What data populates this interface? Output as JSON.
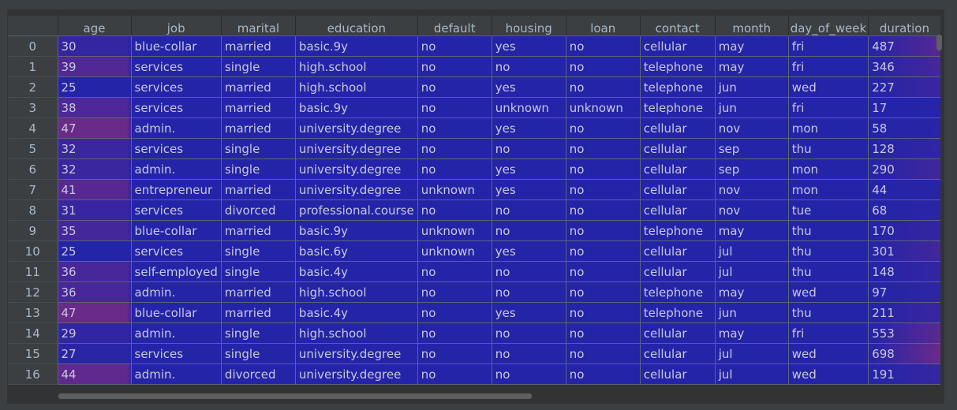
{
  "columns": [
    "",
    "age",
    "job",
    "marital",
    "education",
    "default",
    "housing",
    "loan",
    "contact",
    "month",
    "day_of_week",
    "duration"
  ],
  "rows": [
    [
      "0",
      "30",
      "blue-collar",
      "married",
      "basic.9y",
      "no",
      "yes",
      "no",
      "cellular",
      "may",
      "fri",
      "487"
    ],
    [
      "1",
      "39",
      "services",
      "single",
      "high.school",
      "no",
      "no",
      "no",
      "telephone",
      "may",
      "fri",
      "346"
    ],
    [
      "2",
      "25",
      "services",
      "married",
      "high.school",
      "no",
      "yes",
      "no",
      "telephone",
      "jun",
      "wed",
      "227"
    ],
    [
      "3",
      "38",
      "services",
      "married",
      "basic.9y",
      "no",
      "unknown",
      "unknown",
      "telephone",
      "jun",
      "fri",
      "17"
    ],
    [
      "4",
      "47",
      "admin.",
      "married",
      "university.degree",
      "no",
      "yes",
      "no",
      "cellular",
      "nov",
      "mon",
      "58"
    ],
    [
      "5",
      "32",
      "services",
      "single",
      "university.degree",
      "no",
      "no",
      "no",
      "cellular",
      "sep",
      "thu",
      "128"
    ],
    [
      "6",
      "32",
      "admin.",
      "single",
      "university.degree",
      "no",
      "yes",
      "no",
      "cellular",
      "sep",
      "mon",
      "290"
    ],
    [
      "7",
      "41",
      "entrepreneur",
      "married",
      "university.degree",
      "unknown",
      "yes",
      "no",
      "cellular",
      "nov",
      "mon",
      "44"
    ],
    [
      "8",
      "31",
      "services",
      "divorced",
      "professional.course",
      "no",
      "no",
      "no",
      "cellular",
      "nov",
      "tue",
      "68"
    ],
    [
      "9",
      "35",
      "blue-collar",
      "married",
      "basic.9y",
      "unknown",
      "no",
      "no",
      "telephone",
      "may",
      "thu",
      "170"
    ],
    [
      "10",
      "25",
      "services",
      "single",
      "basic.6y",
      "unknown",
      "yes",
      "no",
      "cellular",
      "jul",
      "thu",
      "301"
    ],
    [
      "11",
      "36",
      "self-employed",
      "single",
      "basic.4y",
      "no",
      "no",
      "no",
      "cellular",
      "jul",
      "thu",
      "148"
    ],
    [
      "12",
      "36",
      "admin.",
      "married",
      "high.school",
      "no",
      "no",
      "no",
      "telephone",
      "may",
      "wed",
      "97"
    ],
    [
      "13",
      "47",
      "blue-collar",
      "married",
      "basic.4y",
      "no",
      "yes",
      "no",
      "telephone",
      "jun",
      "thu",
      "211"
    ],
    [
      "14",
      "29",
      "admin.",
      "single",
      "high.school",
      "no",
      "no",
      "no",
      "cellular",
      "may",
      "fri",
      "553"
    ],
    [
      "15",
      "27",
      "services",
      "single",
      "university.degree",
      "no",
      "no",
      "no",
      "cellular",
      "jul",
      "wed",
      "698"
    ],
    [
      "16",
      "44",
      "admin.",
      "divorced",
      "university.degree",
      "no",
      "no",
      "no",
      "cellular",
      "jul",
      "wed",
      "191"
    ]
  ],
  "colors": {
    "cell_low": "#2424a8",
    "cell_high": "#6a2a8a",
    "header_bg": "#3c3f41",
    "text": "#c8c8dc"
  }
}
